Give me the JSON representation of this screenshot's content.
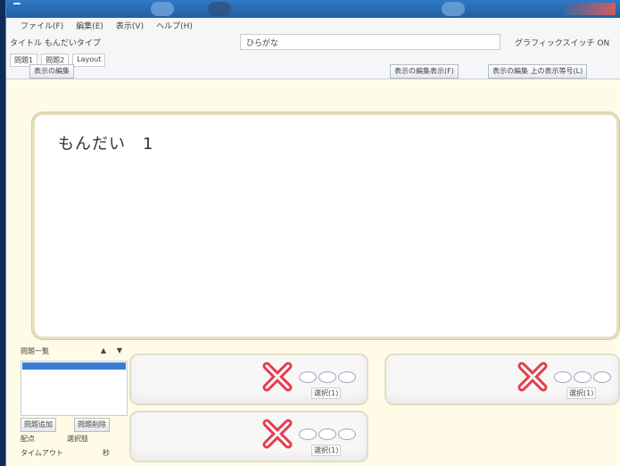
{
  "window": {
    "title": ""
  },
  "menu": [
    "ファイル(F)",
    "編集(E)",
    "表示(V)",
    "ヘルプ(H)"
  ],
  "settings": {
    "label1": "タイトル もんだいタイプ",
    "label2": "ひらがな",
    "label3": "グラフィックスイッチ ON"
  },
  "tabs": [
    "問題1",
    "問題2",
    "Layout"
  ],
  "toolbar": [
    "表示の編集",
    "表示の編集表示(F)",
    "表示の編集 上の表示等号(L)"
  ],
  "question": {
    "text": "もんだい　1"
  },
  "left_panel": {
    "header": "問題一覧",
    "buttons": [
      "問題追加",
      "問題削除"
    ],
    "rows": [
      {
        "left": "配点",
        "right": "選択肢"
      },
      {
        "left": "タイムアウト",
        "right": "秒"
      }
    ]
  },
  "answer_label": "選択(1)",
  "colors": {
    "cross": "#e53d4d",
    "question_bg": "#ffffff",
    "window_bg": "#fffbe6"
  }
}
